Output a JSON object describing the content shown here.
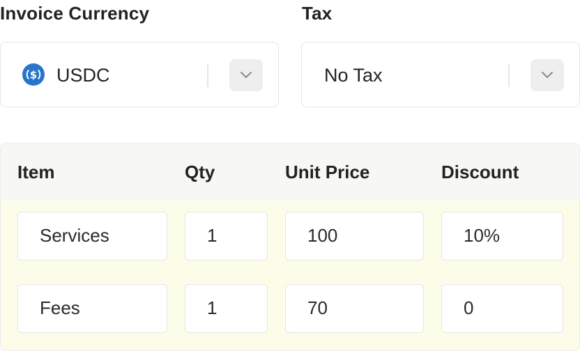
{
  "invoice_currency": {
    "label": "Invoice Currency",
    "selected": "USDC",
    "icon": "usdc-coin-icon",
    "icon_color": "#2775ca"
  },
  "tax": {
    "label": "Tax",
    "selected": "No Tax"
  },
  "items_table": {
    "columns": [
      "Item",
      "Qty",
      "Unit Price",
      "Discount"
    ],
    "rows": [
      {
        "item": "Services",
        "qty": "1",
        "unit_price": "100",
        "discount": "10%"
      },
      {
        "item": "Fees",
        "qty": "1",
        "unit_price": "70",
        "discount": "0"
      }
    ],
    "row_background": "#fbfde9"
  }
}
